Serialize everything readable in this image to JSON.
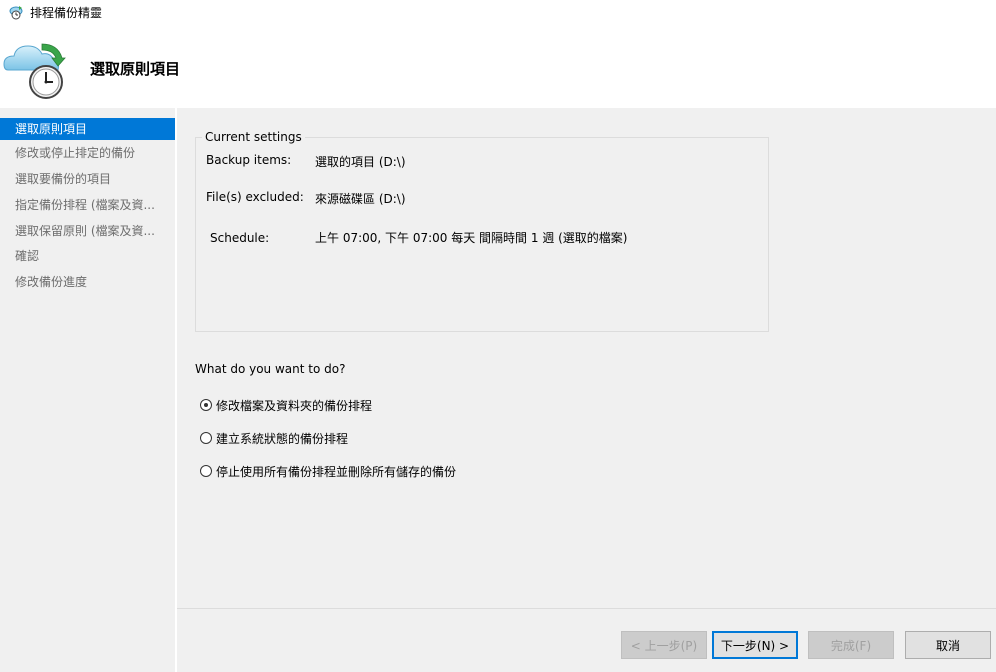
{
  "window": {
    "title": "排程備份精靈"
  },
  "header": {
    "heading": "選取原則項目"
  },
  "sidebar": {
    "items": [
      {
        "label": "選取原則項目",
        "active": true
      },
      {
        "label": "修改或停止排定的備份"
      },
      {
        "label": "選取要備份的項目"
      },
      {
        "label": "指定備份排程 (檔案及資..."
      },
      {
        "label": "選取保留原則 (檔案及資..."
      },
      {
        "label": "確認"
      },
      {
        "label": "修改備份進度"
      }
    ]
  },
  "settings": {
    "legend": "Current settings",
    "rows": [
      {
        "label": "Backup items:",
        "value": "選取的項目 (D:\\)"
      },
      {
        "label": "File(s) excluded:",
        "value": "來源磁碟區 (D:\\)"
      },
      {
        "label": "Schedule:",
        "value": "上午 07:00, 下午 07:00 每天 間隔時間 1 週 (選取的檔案)"
      }
    ]
  },
  "options": {
    "question": "What do you want to do?",
    "choices": [
      {
        "label": "修改檔案及資料夾的備份排程",
        "checked": true
      },
      {
        "label": "建立系統狀態的備份排程",
        "checked": false
      },
      {
        "label": "停止使用所有備份排程並刪除所有儲存的備份",
        "checked": false
      }
    ]
  },
  "buttons": {
    "back": "< 上一步(P)",
    "next": "下一步(N) >",
    "finish": "完成(F)",
    "cancel": "取消"
  }
}
